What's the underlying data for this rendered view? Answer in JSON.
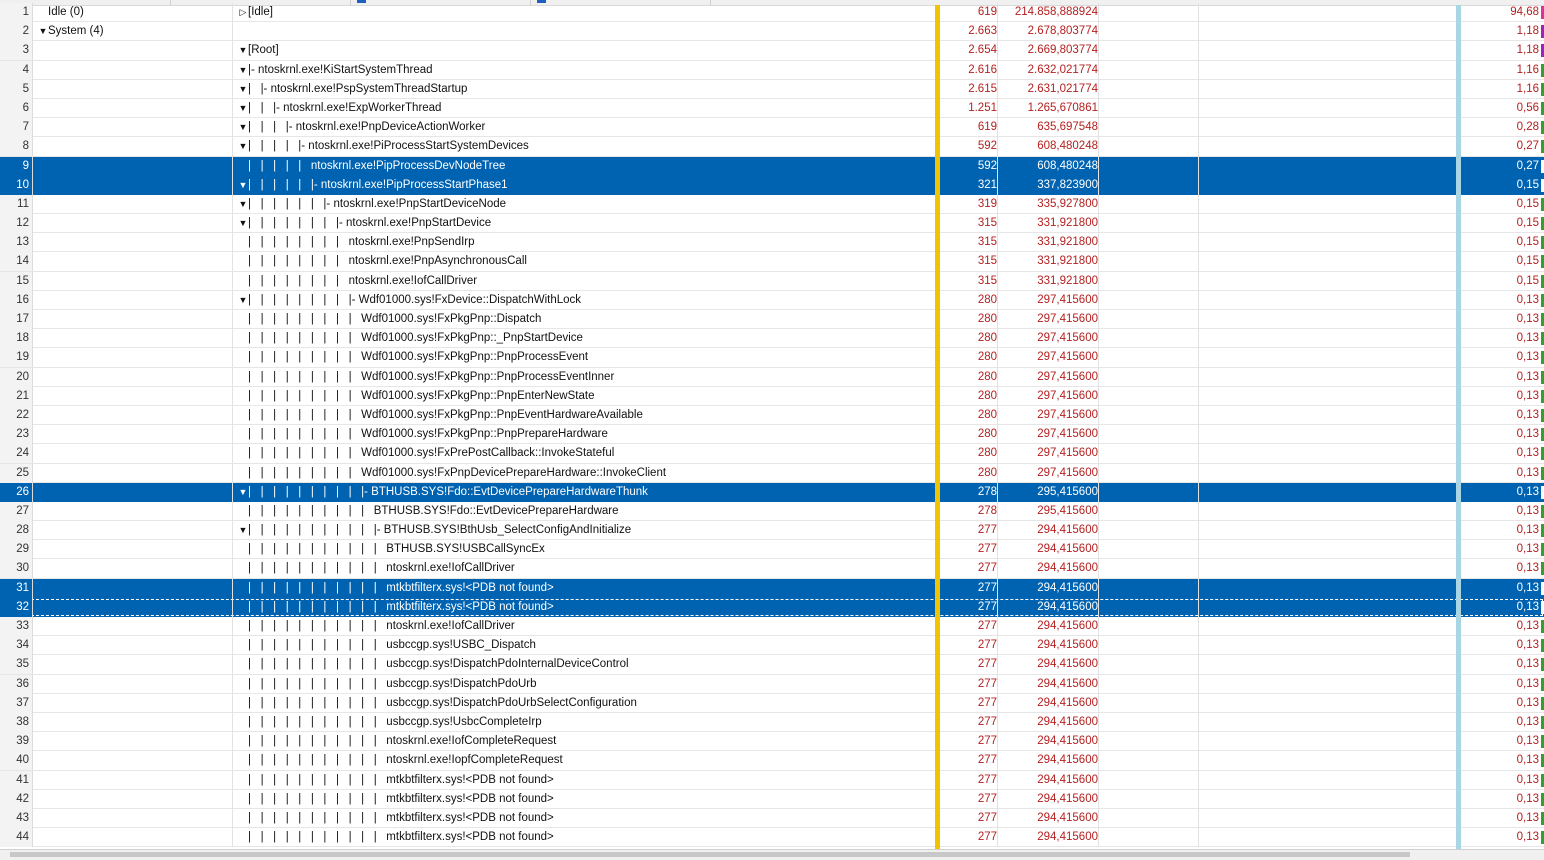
{
  "accent": {
    "selection": "#0063b1",
    "value_red": "#b42020",
    "gold_divider": "#f2c400",
    "blue_divider": "#a9d6e5"
  },
  "rows": [
    {
      "n": "1",
      "proc": "Idle (0)",
      "ptw": "",
      "stw": "▷",
      "stack": "[Idle]",
      "count": "619",
      "weight": "214.858,888924",
      "pct": "94,68",
      "bar": "#e0309a",
      "sel": false
    },
    {
      "n": "2",
      "proc": "System (4)",
      "ptw": "▼",
      "stw": "",
      "stack": "",
      "count": "2.663",
      "weight": "2.678,803774",
      "pct": "1,18",
      "bar": "#a020c0",
      "sel": false
    },
    {
      "n": "3",
      "proc": "",
      "ptw": "",
      "stw": "▼",
      "stack": "[Root]",
      "count": "2.654",
      "weight": "2.669,803774",
      "pct": "1,18",
      "bar": "#a020c0",
      "sel": false
    },
    {
      "n": "4",
      "proc": "",
      "ptw": "",
      "stw": "▼",
      "stack": "|- ntoskrnl.exe!KiStartSystemThread",
      "count": "2.616",
      "weight": "2.632,021774",
      "pct": "1,16",
      "bar": "#30a030",
      "sel": false
    },
    {
      "n": "5",
      "proc": "",
      "ptw": "",
      "stw": "▼",
      "stack": "|   |- ntoskrnl.exe!PspSystemThreadStartup",
      "count": "2.615",
      "weight": "2.631,021774",
      "pct": "1,16",
      "bar": "#30a030",
      "sel": false
    },
    {
      "n": "6",
      "proc": "",
      "ptw": "",
      "stw": "▼",
      "stack": "|   |   |- ntoskrnl.exe!ExpWorkerThread",
      "count": "1.251",
      "weight": "1.265,670861",
      "pct": "0,56",
      "bar": "#30a030",
      "sel": false
    },
    {
      "n": "7",
      "proc": "",
      "ptw": "",
      "stw": "▼",
      "stack": "|   |   |   |- ntoskrnl.exe!PnpDeviceActionWorker",
      "count": "619",
      "weight": "635,697548",
      "pct": "0,28",
      "bar": "#30a030",
      "sel": false
    },
    {
      "n": "8",
      "proc": "",
      "ptw": "",
      "stw": "▼",
      "stack": "|   |   |   |   |- ntoskrnl.exe!PiProcessStartSystemDevices",
      "count": "592",
      "weight": "608,480248",
      "pct": "0,27",
      "bar": "#30a030",
      "sel": false
    },
    {
      "n": "9",
      "proc": "",
      "ptw": "",
      "stw": "",
      "stack": "|   |   |   |   |   ntoskrnl.exe!PipProcessDevNodeTree",
      "count": "592",
      "weight": "608,480248",
      "pct": "0,27",
      "bar": "#ffffff",
      "sel": true
    },
    {
      "n": "10",
      "proc": "",
      "ptw": "",
      "stw": "▼",
      "stack": "|   |   |   |   |   |- ntoskrnl.exe!PipProcessStartPhase1",
      "count": "321",
      "weight": "337,823900",
      "pct": "0,15",
      "bar": "#ffffff",
      "sel": true
    },
    {
      "n": "11",
      "proc": "",
      "ptw": "",
      "stw": "▼",
      "stack": "|   |   |   |   |   |   |- ntoskrnl.exe!PnpStartDeviceNode",
      "count": "319",
      "weight": "335,927800",
      "pct": "0,15",
      "bar": "#30a030",
      "sel": false
    },
    {
      "n": "12",
      "proc": "",
      "ptw": "",
      "stw": "▼",
      "stack": "|   |   |   |   |   |   |   |- ntoskrnl.exe!PnpStartDevice",
      "count": "315",
      "weight": "331,921800",
      "pct": "0,15",
      "bar": "#30a030",
      "sel": false
    },
    {
      "n": "13",
      "proc": "",
      "ptw": "",
      "stw": "",
      "stack": "|   |   |   |   |   |   |   |   ntoskrnl.exe!PnpSendIrp",
      "count": "315",
      "weight": "331,921800",
      "pct": "0,15",
      "bar": "#30a030",
      "sel": false
    },
    {
      "n": "14",
      "proc": "",
      "ptw": "",
      "stw": "",
      "stack": "|   |   |   |   |   |   |   |   ntoskrnl.exe!PnpAsynchronousCall",
      "count": "315",
      "weight": "331,921800",
      "pct": "0,15",
      "bar": "#30a030",
      "sel": false
    },
    {
      "n": "15",
      "proc": "",
      "ptw": "",
      "stw": "",
      "stack": "|   |   |   |   |   |   |   |   ntoskrnl.exe!IofCallDriver",
      "count": "315",
      "weight": "331,921800",
      "pct": "0,15",
      "bar": "#30a030",
      "sel": false
    },
    {
      "n": "16",
      "proc": "",
      "ptw": "",
      "stw": "▼",
      "stack": "|   |   |   |   |   |   |   |   |- Wdf01000.sys!FxDevice::DispatchWithLock",
      "count": "280",
      "weight": "297,415600",
      "pct": "0,13",
      "bar": "#30a030",
      "sel": false
    },
    {
      "n": "17",
      "proc": "",
      "ptw": "",
      "stw": "",
      "stack": "|   |   |   |   |   |   |   |   |   Wdf01000.sys!FxPkgPnp::Dispatch",
      "count": "280",
      "weight": "297,415600",
      "pct": "0,13",
      "bar": "#30a030",
      "sel": false
    },
    {
      "n": "18",
      "proc": "",
      "ptw": "",
      "stw": "",
      "stack": "|   |   |   |   |   |   |   |   |   Wdf01000.sys!FxPkgPnp::_PnpStartDevice",
      "count": "280",
      "weight": "297,415600",
      "pct": "0,13",
      "bar": "#30a030",
      "sel": false
    },
    {
      "n": "19",
      "proc": "",
      "ptw": "",
      "stw": "",
      "stack": "|   |   |   |   |   |   |   |   |   Wdf01000.sys!FxPkgPnp::PnpProcessEvent",
      "count": "280",
      "weight": "297,415600",
      "pct": "0,13",
      "bar": "#30a030",
      "sel": false
    },
    {
      "n": "20",
      "proc": "",
      "ptw": "",
      "stw": "",
      "stack": "|   |   |   |   |   |   |   |   |   Wdf01000.sys!FxPkgPnp::PnpProcessEventInner",
      "count": "280",
      "weight": "297,415600",
      "pct": "0,13",
      "bar": "#30a030",
      "sel": false
    },
    {
      "n": "21",
      "proc": "",
      "ptw": "",
      "stw": "",
      "stack": "|   |   |   |   |   |   |   |   |   Wdf01000.sys!FxPkgPnp::PnpEnterNewState",
      "count": "280",
      "weight": "297,415600",
      "pct": "0,13",
      "bar": "#30a030",
      "sel": false
    },
    {
      "n": "22",
      "proc": "",
      "ptw": "",
      "stw": "",
      "stack": "|   |   |   |   |   |   |   |   |   Wdf01000.sys!FxPkgPnp::PnpEventHardwareAvailable",
      "count": "280",
      "weight": "297,415600",
      "pct": "0,13",
      "bar": "#30a030",
      "sel": false
    },
    {
      "n": "23",
      "proc": "",
      "ptw": "",
      "stw": "",
      "stack": "|   |   |   |   |   |   |   |   |   Wdf01000.sys!FxPkgPnp::PnpPrepareHardware",
      "count": "280",
      "weight": "297,415600",
      "pct": "0,13",
      "bar": "#30a030",
      "sel": false
    },
    {
      "n": "24",
      "proc": "",
      "ptw": "",
      "stw": "",
      "stack": "|   |   |   |   |   |   |   |   |   Wdf01000.sys!FxPrePostCallback::InvokeStateful",
      "count": "280",
      "weight": "297,415600",
      "pct": "0,13",
      "bar": "#30a030",
      "sel": false
    },
    {
      "n": "25",
      "proc": "",
      "ptw": "",
      "stw": "",
      "stack": "|   |   |   |   |   |   |   |   |   Wdf01000.sys!FxPnpDevicePrepareHardware::InvokeClient",
      "count": "280",
      "weight": "297,415600",
      "pct": "0,13",
      "bar": "#30a030",
      "sel": false
    },
    {
      "n": "26",
      "proc": "",
      "ptw": "",
      "stw": "▼",
      "stack": "|   |   |   |   |   |   |   |   |   |- BTHUSB.SYS!Fdo::EvtDevicePrepareHardwareThunk",
      "count": "278",
      "weight": "295,415600",
      "pct": "0,13",
      "bar": "#ffffff",
      "sel": true
    },
    {
      "n": "27",
      "proc": "",
      "ptw": "",
      "stw": "",
      "stack": "|   |   |   |   |   |   |   |   |   |   BTHUSB.SYS!Fdo::EvtDevicePrepareHardware",
      "count": "278",
      "weight": "295,415600",
      "pct": "0,13",
      "bar": "#30a030",
      "sel": false
    },
    {
      "n": "28",
      "proc": "",
      "ptw": "",
      "stw": "▼",
      "stack": "|   |   |   |   |   |   |   |   |   |   |- BTHUSB.SYS!BthUsb_SelectConfigAndInitialize",
      "count": "277",
      "weight": "294,415600",
      "pct": "0,13",
      "bar": "#30a030",
      "sel": false
    },
    {
      "n": "29",
      "proc": "",
      "ptw": "",
      "stw": "",
      "stack": "|   |   |   |   |   |   |   |   |   |   |   BTHUSB.SYS!USBCallSyncEx",
      "count": "277",
      "weight": "294,415600",
      "pct": "0,13",
      "bar": "#30a030",
      "sel": false
    },
    {
      "n": "30",
      "proc": "",
      "ptw": "",
      "stw": "",
      "stack": "|   |   |   |   |   |   |   |   |   |   |   ntoskrnl.exe!IofCallDriver",
      "count": "277",
      "weight": "294,415600",
      "pct": "0,13",
      "bar": "#30a030",
      "sel": false
    },
    {
      "n": "31",
      "proc": "",
      "ptw": "",
      "stw": "",
      "stack": "|   |   |   |   |   |   |   |   |   |   |   mtkbtfilterx.sys!<PDB not found>",
      "count": "277",
      "weight": "294,415600",
      "pct": "0,13",
      "bar": "#ffffff",
      "sel": true
    },
    {
      "n": "32",
      "proc": "",
      "ptw": "",
      "stw": "",
      "stack": "|   |   |   |   |   |   |   |   |   |   |   mtkbtfilterx.sys!<PDB not found>",
      "count": "277",
      "weight": "294,415600",
      "pct": "0,13",
      "bar": "#ffffff",
      "sel": true,
      "focus": true
    },
    {
      "n": "33",
      "proc": "",
      "ptw": "",
      "stw": "",
      "stack": "|   |   |   |   |   |   |   |   |   |   |   ntoskrnl.exe!IofCallDriver",
      "count": "277",
      "weight": "294,415600",
      "pct": "0,13",
      "bar": "#30a030",
      "sel": false
    },
    {
      "n": "34",
      "proc": "",
      "ptw": "",
      "stw": "",
      "stack": "|   |   |   |   |   |   |   |   |   |   |   usbccgp.sys!USBC_Dispatch",
      "count": "277",
      "weight": "294,415600",
      "pct": "0,13",
      "bar": "#30a030",
      "sel": false
    },
    {
      "n": "35",
      "proc": "",
      "ptw": "",
      "stw": "",
      "stack": "|   |   |   |   |   |   |   |   |   |   |   usbccgp.sys!DispatchPdoInternalDeviceControl",
      "count": "277",
      "weight": "294,415600",
      "pct": "0,13",
      "bar": "#30a030",
      "sel": false
    },
    {
      "n": "36",
      "proc": "",
      "ptw": "",
      "stw": "",
      "stack": "|   |   |   |   |   |   |   |   |   |   |   usbccgp.sys!DispatchPdoUrb",
      "count": "277",
      "weight": "294,415600",
      "pct": "0,13",
      "bar": "#30a030",
      "sel": false
    },
    {
      "n": "37",
      "proc": "",
      "ptw": "",
      "stw": "",
      "stack": "|   |   |   |   |   |   |   |   |   |   |   usbccgp.sys!DispatchPdoUrbSelectConfiguration",
      "count": "277",
      "weight": "294,415600",
      "pct": "0,13",
      "bar": "#30a030",
      "sel": false
    },
    {
      "n": "38",
      "proc": "",
      "ptw": "",
      "stw": "",
      "stack": "|   |   |   |   |   |   |   |   |   |   |   usbccgp.sys!UsbcCompleteIrp",
      "count": "277",
      "weight": "294,415600",
      "pct": "0,13",
      "bar": "#30a030",
      "sel": false
    },
    {
      "n": "39",
      "proc": "",
      "ptw": "",
      "stw": "",
      "stack": "|   |   |   |   |   |   |   |   |   |   |   ntoskrnl.exe!IofCompleteRequest",
      "count": "277",
      "weight": "294,415600",
      "pct": "0,13",
      "bar": "#30a030",
      "sel": false
    },
    {
      "n": "40",
      "proc": "",
      "ptw": "",
      "stw": "",
      "stack": "|   |   |   |   |   |   |   |   |   |   |   ntoskrnl.exe!IopfCompleteRequest",
      "count": "277",
      "weight": "294,415600",
      "pct": "0,13",
      "bar": "#30a030",
      "sel": false
    },
    {
      "n": "41",
      "proc": "",
      "ptw": "",
      "stw": "",
      "stack": "|   |   |   |   |   |   |   |   |   |   |   mtkbtfilterx.sys!<PDB not found>",
      "count": "277",
      "weight": "294,415600",
      "pct": "0,13",
      "bar": "#30a030",
      "sel": false
    },
    {
      "n": "42",
      "proc": "",
      "ptw": "",
      "stw": "",
      "stack": "|   |   |   |   |   |   |   |   |   |   |   mtkbtfilterx.sys!<PDB not found>",
      "count": "277",
      "weight": "294,415600",
      "pct": "0,13",
      "bar": "#30a030",
      "sel": false
    },
    {
      "n": "43",
      "proc": "",
      "ptw": "",
      "stw": "",
      "stack": "|   |   |   |   |   |   |   |   |   |   |   mtkbtfilterx.sys!<PDB not found>",
      "count": "277",
      "weight": "294,415600",
      "pct": "0,13",
      "bar": "#30a030",
      "sel": false
    },
    {
      "n": "44",
      "proc": "",
      "ptw": "",
      "stw": "",
      "stack": "|   |   |   |   |   |   |   |   |   |   |   mtkbtfilterx.sys!<PDB not found>",
      "count": "277",
      "weight": "294,415600",
      "pct": "0,13",
      "bar": "#30a030",
      "sel": false
    }
  ]
}
